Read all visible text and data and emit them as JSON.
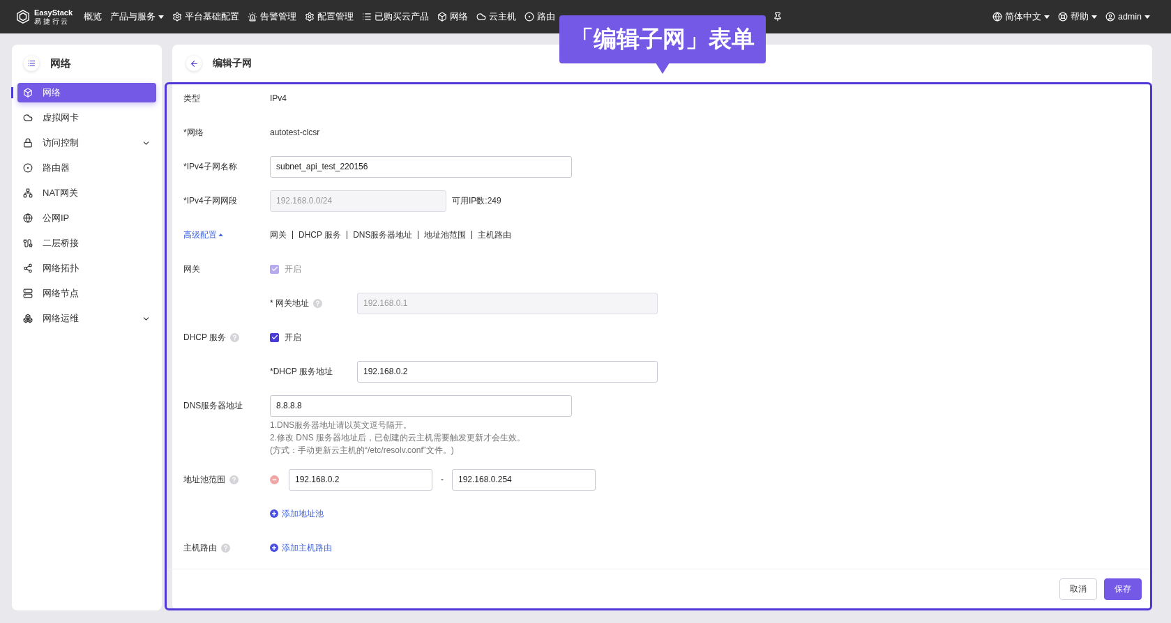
{
  "nav": {
    "logo": {
      "name": "EasyStack",
      "sub": "易 捷 行 云"
    },
    "items": [
      {
        "label": "概览"
      },
      {
        "label": "产品与服务",
        "dropdown": true
      },
      {
        "label": "平台基础配置"
      },
      {
        "label": "告警管理"
      },
      {
        "label": "配置管理"
      },
      {
        "label": "已购买云产品"
      },
      {
        "label": "网络"
      },
      {
        "label": "云主机"
      },
      {
        "label": "路由"
      }
    ],
    "right": [
      {
        "label": "简体中文",
        "dropdown": true
      },
      {
        "label": "帮助",
        "dropdown": true
      },
      {
        "label": "admin",
        "dropdown": true
      }
    ]
  },
  "callout": {
    "text": "「编辑子网」表单"
  },
  "sidebar": {
    "title": "网络",
    "items": [
      {
        "label": "网络",
        "selected": true
      },
      {
        "label": "虚拟网卡",
        "selected": false
      },
      {
        "label": "访问控制",
        "selected": false,
        "expanded": false
      },
      {
        "label": "路由器",
        "selected": false
      },
      {
        "label": "NAT网关",
        "selected": false
      },
      {
        "label": "公网IP",
        "selected": false
      },
      {
        "label": "二层桥接",
        "selected": false
      },
      {
        "label": "网络拓扑",
        "selected": false
      },
      {
        "label": "网络节点",
        "selected": false
      },
      {
        "label": "网络运维",
        "selected": false,
        "expanded": false
      }
    ]
  },
  "page": {
    "title": "编辑子网"
  },
  "form": {
    "fields": [
      {
        "kind": "text",
        "label": "类型",
        "value": "IPv4"
      },
      {
        "kind": "text",
        "label": "*网络",
        "value": "autotest-clcsr"
      },
      {
        "kind": "input",
        "label": "*IPv4子网名称",
        "value": "subnet_api_test_220156",
        "disabled": false
      },
      {
        "kind": "input",
        "label": "*IPv4子网网段",
        "value": "192.168.0.0/24",
        "disabled": true,
        "note": "可用IP数:249"
      },
      {
        "kind": "links",
        "label": "高级配置",
        "expanded": true,
        "links": [
          "网关",
          "DHCP 服务",
          "DNS服务器地址",
          "地址池范围",
          "主机路由"
        ]
      },
      {
        "kind": "checkbox",
        "label": "网关",
        "text": "开启",
        "checked": true,
        "disabled": true
      },
      {
        "kind": "sub_input",
        "label": "* 网关地址",
        "help": true,
        "value": "192.168.0.1",
        "disabled": true
      },
      {
        "kind": "checkbox",
        "label": "DHCP 服务",
        "help": true,
        "text": "开启",
        "checked": true,
        "disabled": false
      },
      {
        "kind": "sub_input",
        "label": "*DHCP 服务地址",
        "value": "192.168.0.2",
        "disabled": false
      },
      {
        "kind": "input",
        "label": "DNS服务器地址",
        "value": "8.8.8.8",
        "disabled": false,
        "hints": [
          "1.DNS服务器地址请以英文逗号隔开。",
          "2.修改 DNS 服务器地址后，已创建的云主机需要触发更新才会生效。",
          "(方式：手动更新云主机的“/etc/resolv.conf”文件。)"
        ]
      },
      {
        "kind": "range",
        "label": "地址池范围",
        "help": true,
        "from": "192.168.0.2",
        "separator": "-",
        "to": "192.168.0.254"
      },
      {
        "kind": "add",
        "action": "添加地址池"
      },
      {
        "kind": "add",
        "label": "主机路由",
        "help": true,
        "action": "添加主机路由"
      }
    ]
  },
  "buttons": [
    {
      "label": "取消",
      "primary": false
    },
    {
      "label": "保存",
      "primary": true
    }
  ]
}
